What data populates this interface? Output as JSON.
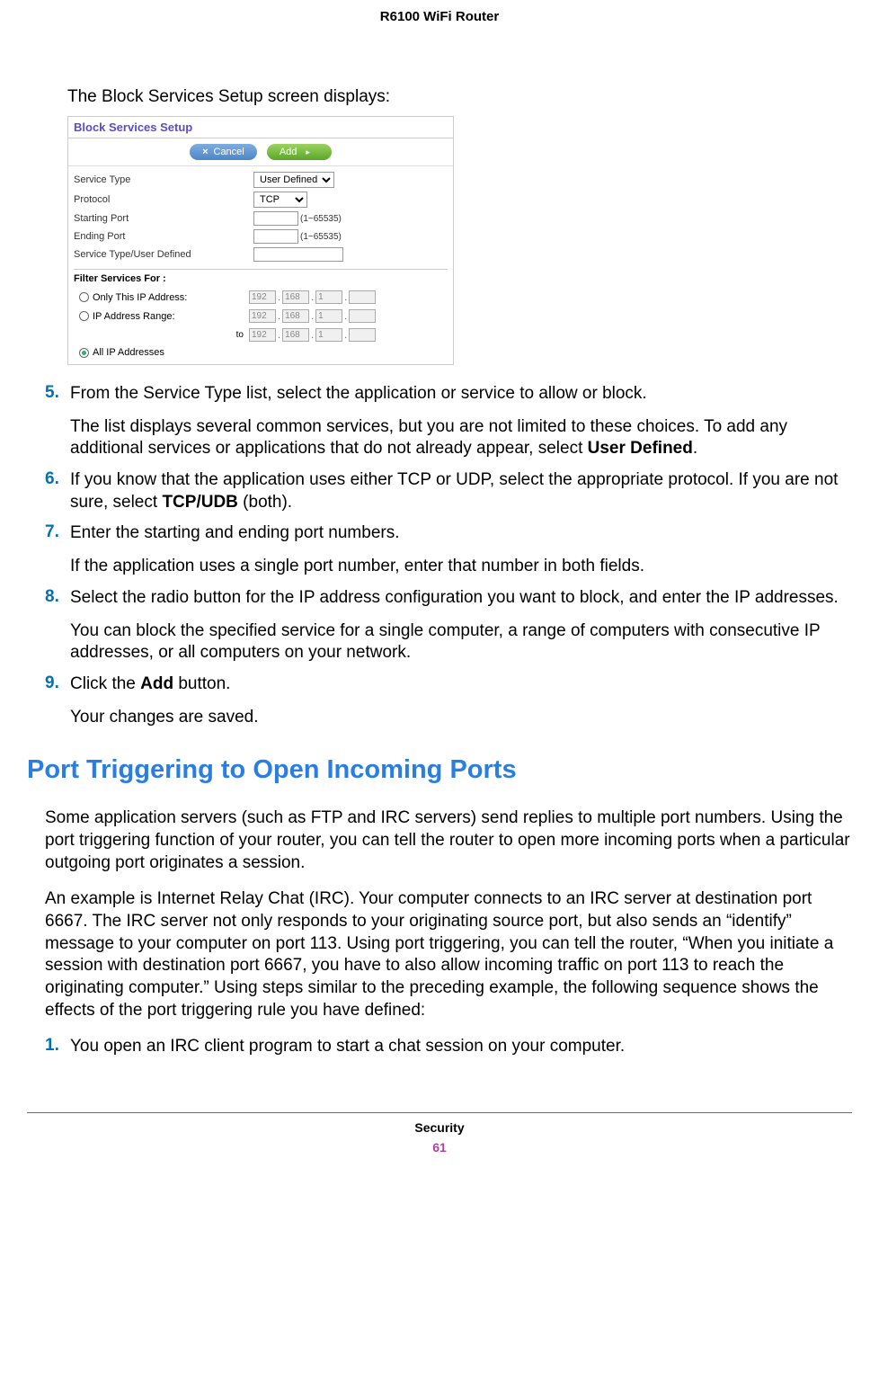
{
  "header": {
    "product": "R6100 WiFi Router"
  },
  "intro": "The Block Services Setup screen displays:",
  "screenshot": {
    "title": "Block Services Setup",
    "buttons": {
      "cancel": "Cancel",
      "add": "Add"
    },
    "fields": {
      "service_type_label": "Service Type",
      "service_type_value": "User Defined",
      "protocol_label": "Protocol",
      "protocol_value": "TCP",
      "starting_port_label": "Starting Port",
      "starting_port_hint": "(1~65535)",
      "ending_port_label": "Ending Port",
      "ending_port_hint": "(1~65535)",
      "service_user_label": "Service Type/User Defined"
    },
    "filter": {
      "title": "Filter Services For :",
      "only_this": "Only This IP Address:",
      "range": "IP Address Range:",
      "to": "to",
      "all": "All IP Addresses",
      "ip1": "192",
      "ip2": "168",
      "ip3": "1"
    }
  },
  "steps": [
    {
      "num": "5.",
      "text": "From the Service Type list, select the application or service to allow or block.",
      "para": "The list displays several common services, but you are not limited to these choices. To add any additional services or applications that do not already appear, select ",
      "bold_suffix": "User Defined",
      "after_bold": "."
    },
    {
      "num": "6.",
      "text_pre": "If you know that the application uses either TCP or UDP, select the appropriate protocol. If you are not sure, select ",
      "bold": "TCP/UDB",
      "text_post": " (both)."
    },
    {
      "num": "7.",
      "text": "Enter the starting and ending port numbers.",
      "para": "If the application uses a single port number, enter that number in both fields."
    },
    {
      "num": "8.",
      "text": "Select the radio button for the IP address configuration you want to block, and enter the IP addresses.",
      "para": "You can block the specified service for a single computer, a range of computers with consecutive IP addresses, or all computers on your network."
    },
    {
      "num": "9.",
      "text_pre": "Click the ",
      "bold": "Add",
      "text_post": " button.",
      "para": "Your changes are saved."
    }
  ],
  "section": {
    "heading": "Port Triggering to Open Incoming Ports",
    "p1": "Some application servers (such as FTP and IRC servers) send replies to multiple port numbers. Using the port triggering function of your router, you can tell the router to open more incoming ports when a particular outgoing port originates a session.",
    "p2": "An example is Internet Relay Chat (IRC). Your computer connects to an IRC server at destination port 6667. The IRC server not only responds to your originating source port, but also sends an “identify” message to your computer on port 113. Using port triggering, you can tell the router, “When you initiate a session with destination port 6667, you have to also allow incoming traffic on port 113 to reach the originating computer.” Using steps similar to the preceding example, the following sequence shows the effects of the port triggering rule you have defined:"
  },
  "steps2": [
    {
      "num": "1.",
      "text": "You open an IRC client program to start a chat session on your computer."
    }
  ],
  "footer": {
    "label": "Security",
    "page": "61"
  }
}
